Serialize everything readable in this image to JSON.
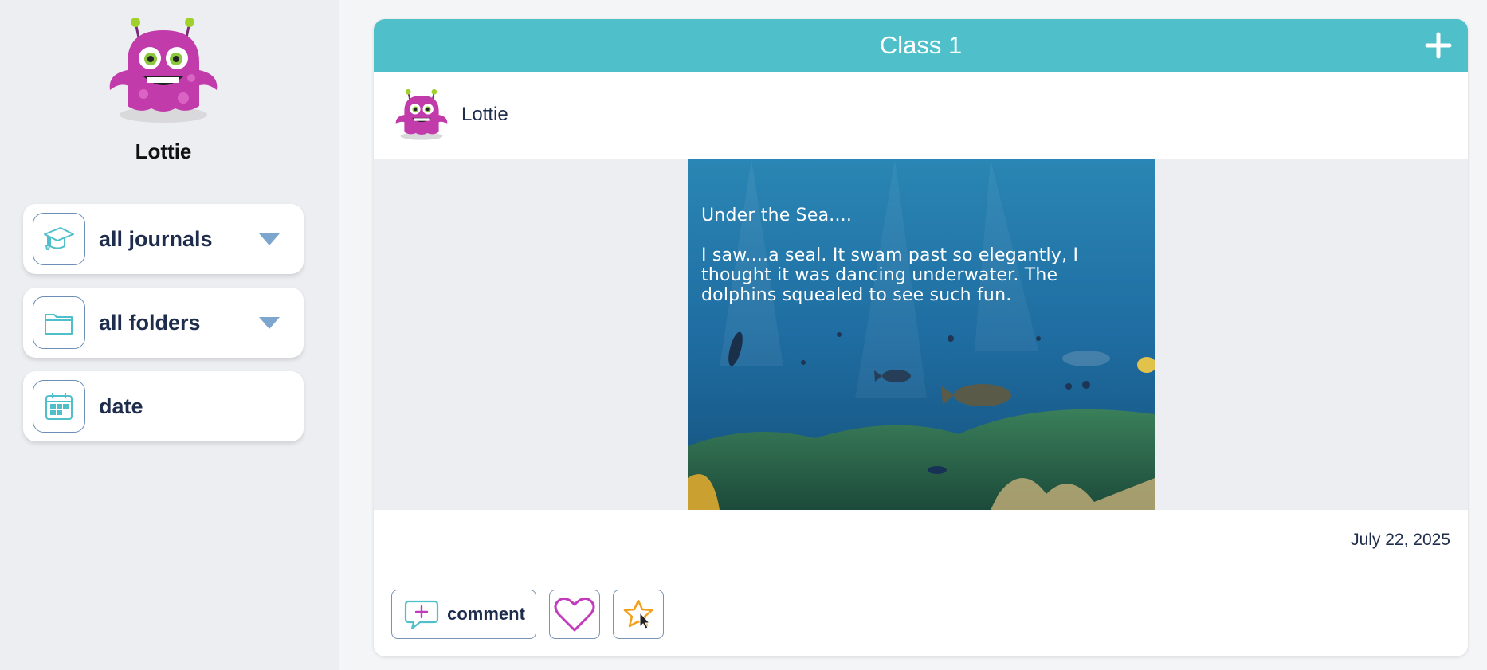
{
  "profile": {
    "name": "Lottie",
    "avatar_icon": "purple-monster-avatar"
  },
  "filters": [
    {
      "label": "all journals",
      "icon": "graduation-cap-icon",
      "has_dropdown": true
    },
    {
      "label": "all folders",
      "icon": "folder-icon",
      "has_dropdown": true
    },
    {
      "label": "date",
      "icon": "calendar-icon",
      "has_dropdown": false
    }
  ],
  "post": {
    "class_title": "Class 1",
    "author": "Lottie",
    "image_text_title": "Under the Sea....",
    "image_text_lines": [
      "I saw....a seal. It swam past so elegantly, I",
      "thought it was dancing underwater. The",
      "dolphins squealed to see such fun."
    ],
    "date": "July 22, 2025"
  },
  "actions": {
    "comment_label": "comment"
  },
  "colors": {
    "header": "#4fc0ca",
    "accent_purple": "#c23bbd",
    "star": "#f0a01e",
    "text_navy": "#1f2d4d"
  }
}
